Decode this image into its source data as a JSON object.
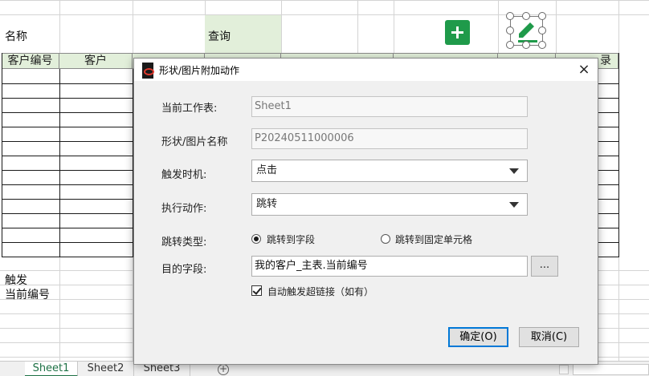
{
  "sheet": {
    "name_label": "名称",
    "query_label": "查询",
    "headers": [
      "客户编号",
      "客户",
      "",
      "",
      "",
      "",
      "",
      "录"
    ],
    "trigger_label": "触发",
    "current_id_label": "当前编号"
  },
  "dialog": {
    "title": "形状/图片附加动作",
    "close_glyph": "×",
    "worksheet_label": "当前工作表:",
    "worksheet_value": "Sheet1",
    "shape_name_label": "形状/图片名称",
    "shape_name_value": "P20240511000006",
    "trigger_label": "触发时机:",
    "trigger_value": "点击",
    "action_label": "执行动作:",
    "action_value": "跳转",
    "jump_type_label": "跳转类型:",
    "jump_options": [
      {
        "label": "跳转到字段",
        "selected": true
      },
      {
        "label": "跳转到固定单元格",
        "selected": false
      }
    ],
    "target_field_label": "目的字段:",
    "target_field_value": "我的客户_主表.当前编号",
    "browse_label": "...",
    "auto_link_label": "自动触发超链接（如有）",
    "auto_link_checked": true,
    "ok_label": "确定(O)",
    "cancel_label": "取消(C)"
  },
  "tabs": [
    {
      "label": "Sheet1",
      "active": true
    },
    {
      "label": "Sheet2",
      "active": false
    },
    {
      "label": "Sheet3",
      "active": false
    }
  ],
  "add_sheet_glyph": "+",
  "colors": {
    "header_fill": "#e2efda",
    "add_button": "#1f9a4a",
    "edit_icon": "#1f9a4a",
    "active_tab": "#1e7145",
    "dialog_bg": "#f0f0f0",
    "default_button_border": "#0078d7"
  },
  "icons": {
    "add": "plus-icon",
    "edit": "pencil-icon",
    "close": "close-icon",
    "dropdown": "chevron-down-icon"
  }
}
